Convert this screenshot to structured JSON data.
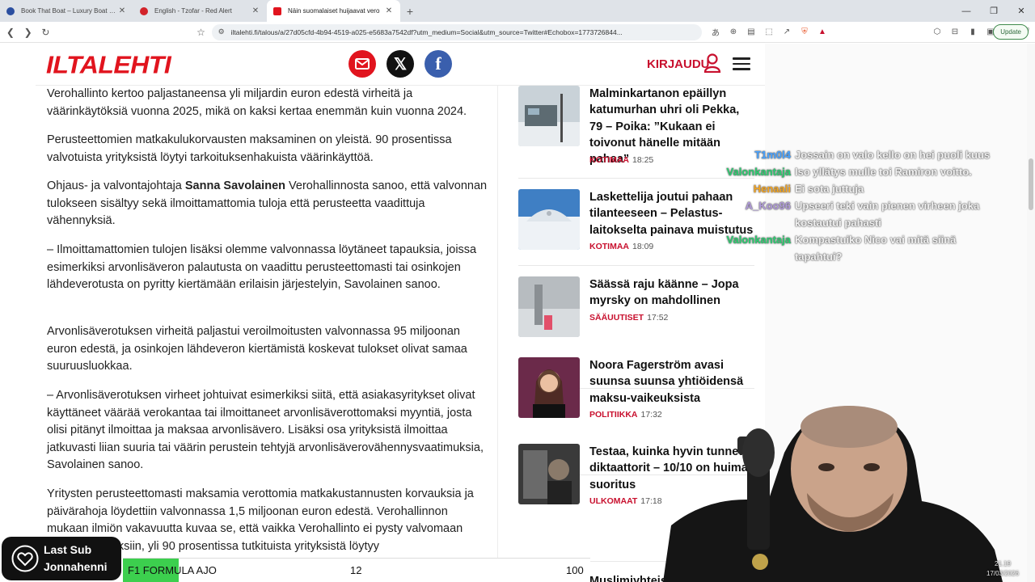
{
  "browser": {
    "tabs": [
      {
        "title": "Book That Boat – Luxury Boat Rental",
        "favicon_color": "#2b4fa0"
      },
      {
        "title": "English - Tzofar - Red Alert",
        "favicon_color": "#d2232a"
      },
      {
        "title": "Näin suomalaiset huijaavat vero",
        "favicon_color": "#e1141e"
      }
    ],
    "url": "iltalehti.fi/talous/a/27d05cfd-4b94-4519-a025-e5683a7542df?utm_medium=Social&utm_source=Twitter#Echobox=1773726844...",
    "update_label": "Update"
  },
  "site": {
    "logo": "ILTALEHTI",
    "login_label": "KIRJAUDU"
  },
  "article": {
    "paragraphs": [
      "Verohallinto kertoo paljastaneensa yli miljardin euron edestä virheitä ja väärinkäytöksiä vuonna 2025, mikä on kaksi kertaa enemmän kuin vuonna 2024.",
      "Perusteettomien matkakulukorvausten maksaminen on yleistä. 90 prosentissa valvotuista yrityksistä löytyi tarkoituksenhakuista väärinkäyttöä.",
      "– Ilmoittamattomien tulojen lisäksi olemme valvonnassa löytäneet tapauksia, joissa esimerkiksi arvonlisäveron palautusta on vaadittu perusteettomasti tai osinkojen lähdeverotusta on pyritty kiertämään erilaisin järjestelyin, Savolainen sanoo.",
      "Arvonlisäverotuksen virheitä paljastui veroilmoitusten valvonnassa 95 miljoonan euron edestä, ja osinkojen lähdeveron kiertämistä koskevat tulokset olivat samaa suuruusluokkaa.",
      "– Arvonlisäverotuksen virheet johtuivat esimerkiksi siitä, että asiakasyritykset olivat käyttäneet väärää verokantaa tai ilmoittaneet arvonlisäverottomaksi myyntiä, josta olisi pitänyt ilmoittaa ja maksaa arvonlisävero. Lisäksi osa yrityksistä ilmoittaa jatkuvasti liian suuria tai väärin perustein tehtyjä arvonlisäverovähennysvaatimuksia, Savolainen sanoo.",
      "Yritysten perusteettomasti maksamia verottomia matkakustannusten korvauksia ja päivärahoja löydettiin valvonnassa 1,5 miljoonan euron edestä. Verohallinnon mukaan ilmiön vakavuutta kuvaa se, että vaikka Verohallinto ei pysty valvomaan kaikkiin tapauksiin, yli 90 prosentissa tutkituista yrityksistä löytyy"
    ],
    "quote_prefix": "Ohjaus- ja valvontajohtaja ",
    "quote_name": "Sanna Savolainen",
    "quote_suffix": " Verohallinnosta sanoo, että valvonnan tulokseen sisältyy sekä ilmoittamattomia tuloja että perusteetta vaadittuja vähennyksiä."
  },
  "sidebar": {
    "items": [
      {
        "headline": "Malminkartanon epäillyn katumurhan uhri oli Pekka, 79 – Poika: ”Kukaan ei toivonut hänelle mitään pahaa”",
        "category": "KOTIMAA",
        "time": "18:25"
      },
      {
        "headline": "Laskettelija joutui pahaan tilanteeseen – Pelastus-laitokselta painava muistutus",
        "category": "KOTIMAA",
        "time": "18:09"
      },
      {
        "headline": "Säässä raju käänne – Jopa myrsky on mahdollinen",
        "category": "SÄÄUUTISET",
        "time": "17:52"
      },
      {
        "headline": "Noora Fagerström avasi suunsa suunsa yhtiöidensä maksu-vaikeuksista",
        "category": "POLITIIKKA",
        "time": "17:32"
      },
      {
        "headline": "Testaa, kuinka hyvin tunnet diktaattorit – 10/10 on huima suoritus",
        "category": "ULKOMAAT",
        "time": "17:18"
      },
      {
        "headline": "Muslimiyhteisö vaatimus",
        "category": "",
        "time": ""
      }
    ]
  },
  "chat": {
    "messages": [
      {
        "user": "T1m0l4",
        "user_color": "#4aa3ff",
        "text": "Jossain on valo kello on hei puoli kuus"
      },
      {
        "user": "Valonkantaja",
        "user_color": "#2ecc71",
        "text": "Iso yllätys mulle toi Ramiron voitto."
      },
      {
        "user": "Henaali",
        "user_color": "#f5a623",
        "text": "Ei sota juttuja"
      },
      {
        "user": "A_Koo96",
        "user_color": "#b19cd9",
        "text": "Upseeri teki vain pienen virheen joka",
        "text2": "kostautui pahasti"
      },
      {
        "user": "Valonkantaja",
        "user_color": "#2ecc71",
        "text": "Kompastuiko Nico vai mitä siinä",
        "text2": "tapahtui?"
      }
    ]
  },
  "overlay": {
    "last_sub_label": "Last Sub",
    "last_sub_name": "Jonnahenni",
    "ticker_label": "F1 FORMULA AJO",
    "ticker_value": "12",
    "ticker_max": "100",
    "ticker_progress": 0.12,
    "clock_time": "21.19",
    "clock_date": "17/03/2026"
  }
}
